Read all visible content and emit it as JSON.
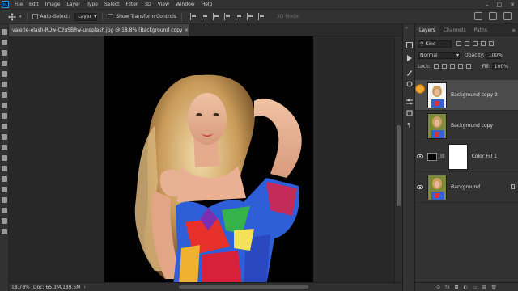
{
  "menu": {
    "app_icon": "photoshop-logo",
    "items": [
      "File",
      "Edit",
      "Image",
      "Layer",
      "Type",
      "Select",
      "Filter",
      "3D",
      "View",
      "Window",
      "Help"
    ],
    "window_controls": [
      "–",
      "□",
      "✕"
    ]
  },
  "options_bar": {
    "auto_select_label": "Auto-Select:",
    "auto_select_target": "Layer",
    "transform_controls_label": "Show Transform Controls",
    "mode_3d_label": "3D Mode:"
  },
  "document": {
    "tab_title": "valerie-elash-RUw-C2uSBRw-unsplash.jpg @ 18.8% (Background copy 2, RGB/8) *",
    "close": "×"
  },
  "status": {
    "zoom": "18.78%",
    "doc_size": "Doc: 65.3M/189.5M",
    "arrow": "›"
  },
  "layers_panel": {
    "tabs": [
      "Layers",
      "Channels",
      "Paths"
    ],
    "active_tab": "Layers",
    "menu_icon": "≡",
    "kind_label": "Kind",
    "blend_mode": "Normal",
    "opacity_label": "Opacity:",
    "opacity_value": "100%",
    "lock_label": "Lock:",
    "fill_label": "Fill:",
    "fill_value": "100%",
    "layers": [
      {
        "name": "Background copy 2",
        "visible": false,
        "selected": true
      },
      {
        "name": "Background copy",
        "visible": false,
        "selected": false
      },
      {
        "name": "Color Fill 1",
        "visible": true,
        "selected": false
      },
      {
        "name": "Background",
        "visible": true,
        "selected": false,
        "locked": true
      }
    ],
    "footer_icons": [
      "link-icon",
      "fx-icon",
      "mask-icon",
      "adjustment-icon",
      "group-icon",
      "new-layer-icon",
      "trash-icon"
    ],
    "footer_labels": [
      "⊝",
      "fx",
      "◘",
      "◐",
      "▭",
      "⊞",
      "🗑"
    ]
  },
  "colors": {
    "ui_dark": "#282828",
    "panel": "#323232",
    "selected_layer": "#4b4b4b",
    "cursor_highlight": "#f0a830"
  }
}
